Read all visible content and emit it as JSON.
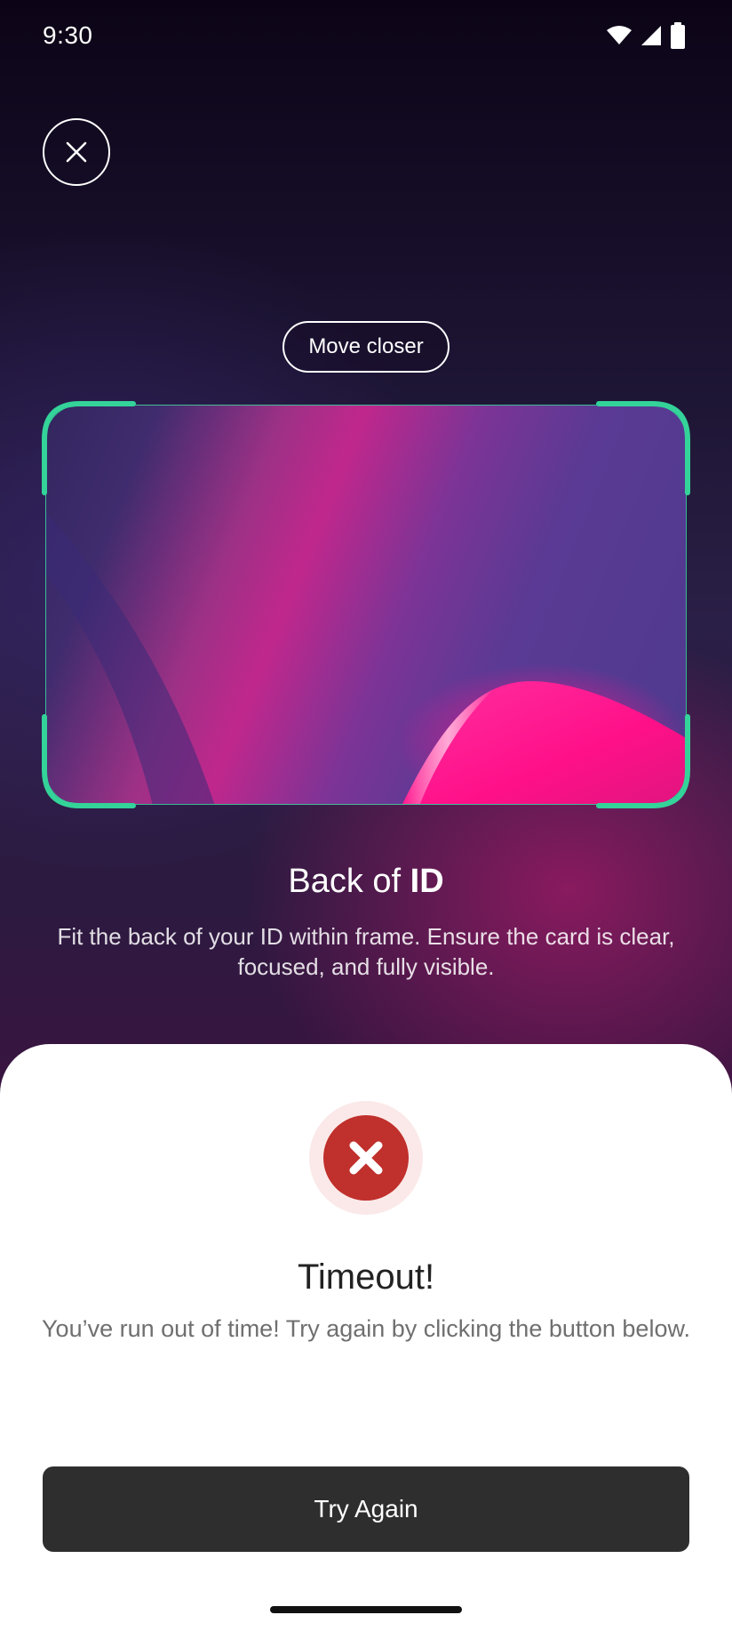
{
  "status_bar": {
    "time": "9:30",
    "icons": [
      "wifi-icon",
      "cellular-signal-icon",
      "battery-icon"
    ]
  },
  "header": {
    "close_icon": "close-icon"
  },
  "camera": {
    "hint": "Move closer",
    "frame_color": "#34d399"
  },
  "caption": {
    "title_prefix": "Back of ",
    "title_emphasis": "ID",
    "description": "Fit the back of your ID within frame. Ensure the card is clear, focused, and fully visible."
  },
  "sheet": {
    "icon": "error-x-icon",
    "icon_color": "#c0302c",
    "title": "Timeout!",
    "description": "You’ve run out of time! Try again by clicking the button below.",
    "button_label": "Try Again"
  }
}
